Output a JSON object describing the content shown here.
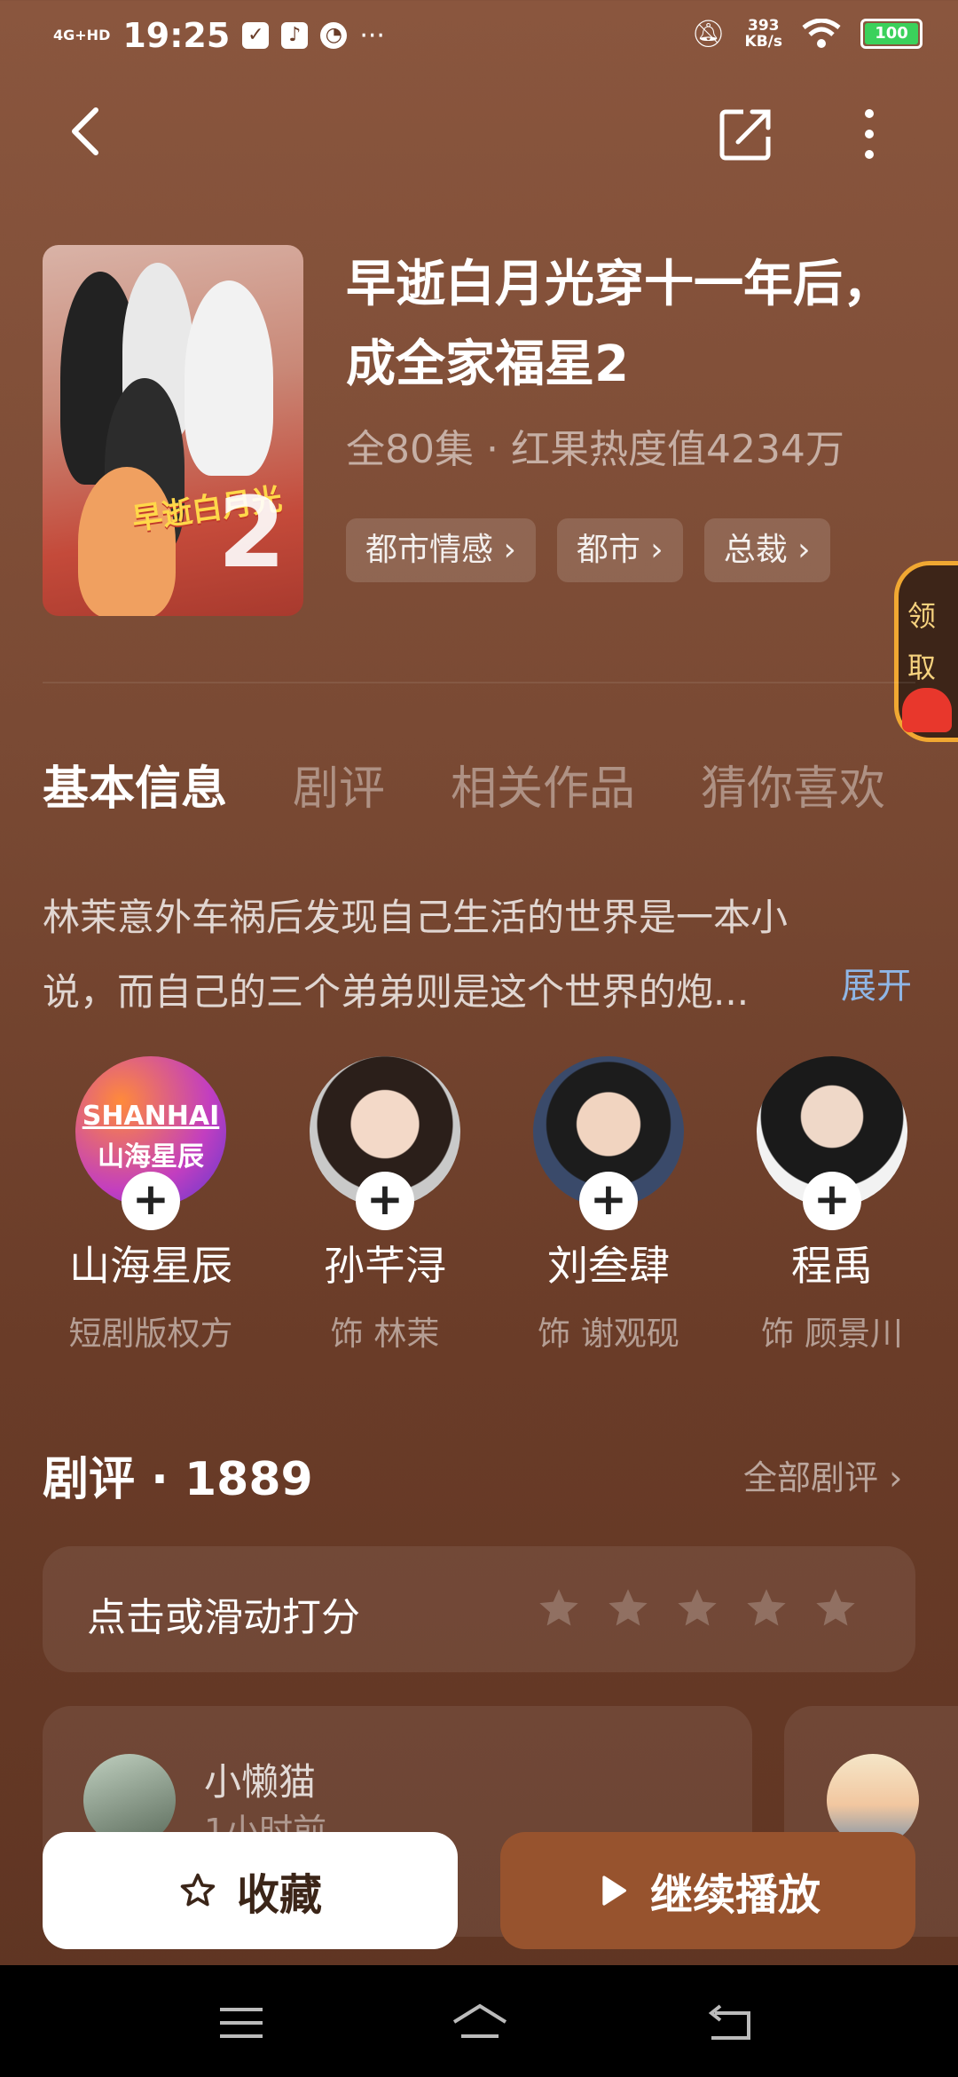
{
  "status_bar": {
    "network": "4G+HD",
    "time": "19:25",
    "net_speed_value": "393",
    "net_speed_unit": "KB/s",
    "battery": "100"
  },
  "drama": {
    "title": "早逝白月光穿十一年后，成全家福星2",
    "meta": "全80集 · 红果热度值4234万",
    "tags": [
      "都市情感 ›",
      "都市 ›",
      "总裁 ›"
    ],
    "cover_title": "早逝白月光",
    "cover_number": "2"
  },
  "side_widget": {
    "label_1": "领",
    "label_2": "取"
  },
  "tabs": [
    "基本信息",
    "剧评",
    "相关作品",
    "猜你喜欢"
  ],
  "description": {
    "text": "林茉意外车祸后发现自己生活的世界是一本小说，而自己的三个弟弟则是这个世界的炮...",
    "expand": "展开"
  },
  "cast": [
    {
      "name": "山海星辰",
      "role": "短剧版权方",
      "logo_text_1": "SHANHAI",
      "logo_text_2": "山海星辰"
    },
    {
      "name": "孙芊浔",
      "role": "饰 林茉"
    },
    {
      "name": "刘叁肆",
      "role": "饰 谢观砚"
    },
    {
      "name": "程禹",
      "role": "饰 顾景川"
    }
  ],
  "reviews": {
    "title": "剧评 · 1889",
    "all_label": "全部剧评 ›",
    "rate_prompt": "点击或滑动打分",
    "first_review": {
      "user": "小懒猫",
      "time": "1小时前"
    }
  },
  "actions": {
    "favorite": "收藏",
    "continue": "继续播放"
  },
  "colors": {
    "accent_play": "#97532e",
    "battery": "#3bd15b",
    "expand_link": "#8fb6e6"
  }
}
